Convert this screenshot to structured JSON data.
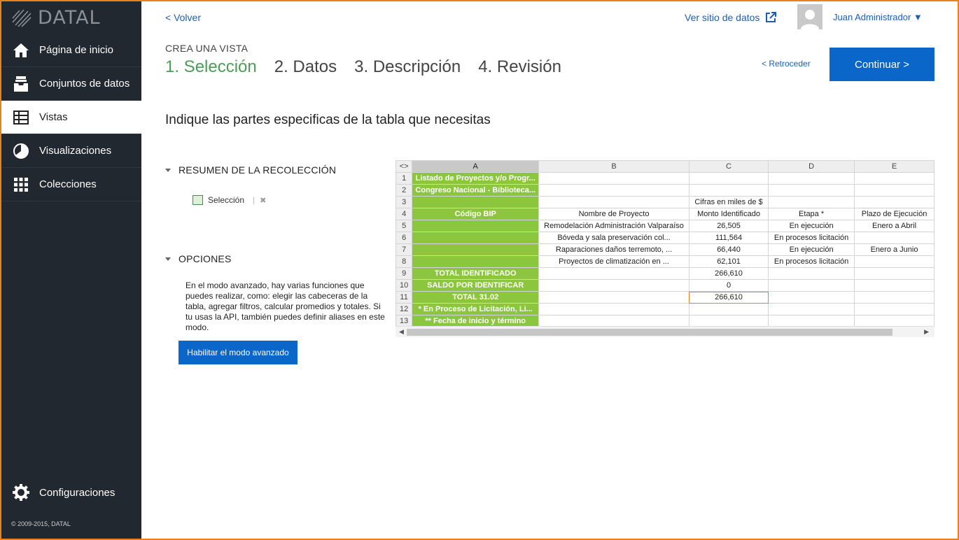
{
  "brand": {
    "name": "DATAL"
  },
  "sidebar": {
    "items": [
      {
        "label": "Página de inicio",
        "icon": "home-icon"
      },
      {
        "label": "Conjuntos de datos",
        "icon": "inbox-icon"
      },
      {
        "label": "Vistas",
        "icon": "table-icon"
      },
      {
        "label": "Visualizaciones",
        "icon": "pie-chart-icon"
      },
      {
        "label": "Colecciones",
        "icon": "grid-icon"
      }
    ],
    "active": "Vistas",
    "settings_label": "Configuraciones",
    "copyright": "© 2009-2015, DATAL"
  },
  "header": {
    "back_label": "< Volver",
    "view_data_label": "Ver sitio de datos",
    "user_name": "Juan Administrador ▼"
  },
  "wizard": {
    "kicker": "CREA UNA VISTA",
    "steps": [
      "1. Selección",
      "2. Datos",
      "3. Descripción",
      "4. Revisión"
    ],
    "current_step": 1,
    "retro_label": "< Retroceder",
    "continue_label": "Continuar >"
  },
  "instruction": "Indique las partes especificas de la tabla que necesitas",
  "summary": {
    "title": "RESUMEN DE LA RECOLECCIÓN",
    "selection_label": "Selección",
    "remove_glyph": "✖"
  },
  "options": {
    "title": "OPCIONES",
    "text": "En el modo avanzado, hay varias funciones que puedes realizar, como: elegir las cabeceras de la tabla, agregar filtros, calcular promedios y totales. Si tu usas la API, también puedes definir aliases en este modo.",
    "button_label": "Habilitar el modo avanzado"
  },
  "sheet": {
    "corner": "<>",
    "columns": [
      "A",
      "B",
      "C",
      "D",
      "E"
    ],
    "rows": [
      [
        "1",
        "Listado de Proyectos y/o Progr...",
        "",
        "",
        "",
        ""
      ],
      [
        "2",
        "Congreso Nacional - Biblioteca...",
        "",
        "",
        "",
        ""
      ],
      [
        "3",
        "",
        "",
        "Cifras en miles de $",
        "",
        ""
      ],
      [
        "4",
        "Código BIP",
        "Nombre de Proyecto",
        "Monto Identificado",
        "Etapa *",
        "Plazo de Ejecución"
      ],
      [
        "5",
        "",
        "Remodelación Administración Valparaíso",
        "26,505",
        "En ejecución",
        "Enero a Abril"
      ],
      [
        "6",
        "",
        "Bóveda y sala preservación col...",
        "111,564",
        "En procesos licitación",
        ""
      ],
      [
        "7",
        "",
        "Raparaciones daños terremoto, ...",
        "66,440",
        "En ejecución",
        "Enero a Junio"
      ],
      [
        "8",
        "",
        "Proyectos de climatización en ...",
        "62,101",
        "En procesos licitación",
        ""
      ],
      [
        "9",
        "TOTAL IDENTIFICADO",
        "",
        "266,610",
        "",
        ""
      ],
      [
        "10",
        "SALDO POR IDENTIFICAR",
        "",
        "0",
        "",
        ""
      ],
      [
        "11",
        "TOTAL 31.02",
        "",
        "266,610",
        "",
        ""
      ],
      [
        "12",
        "* En Proceso de Licitación, Li...",
        "",
        "",
        "",
        ""
      ],
      [
        "13",
        "** Fecha de inicio y término",
        "",
        "",
        "",
        ""
      ]
    ],
    "selected_column": "A",
    "highlighted_cell": "C11",
    "colors": {
      "selection": "#8cc63f",
      "highlight": "#e8821e"
    }
  },
  "colors": {
    "accent": "#0a66c8",
    "sidebar_bg": "#212830",
    "step_current": "#4a9e55",
    "frame": "#e8821e"
  }
}
